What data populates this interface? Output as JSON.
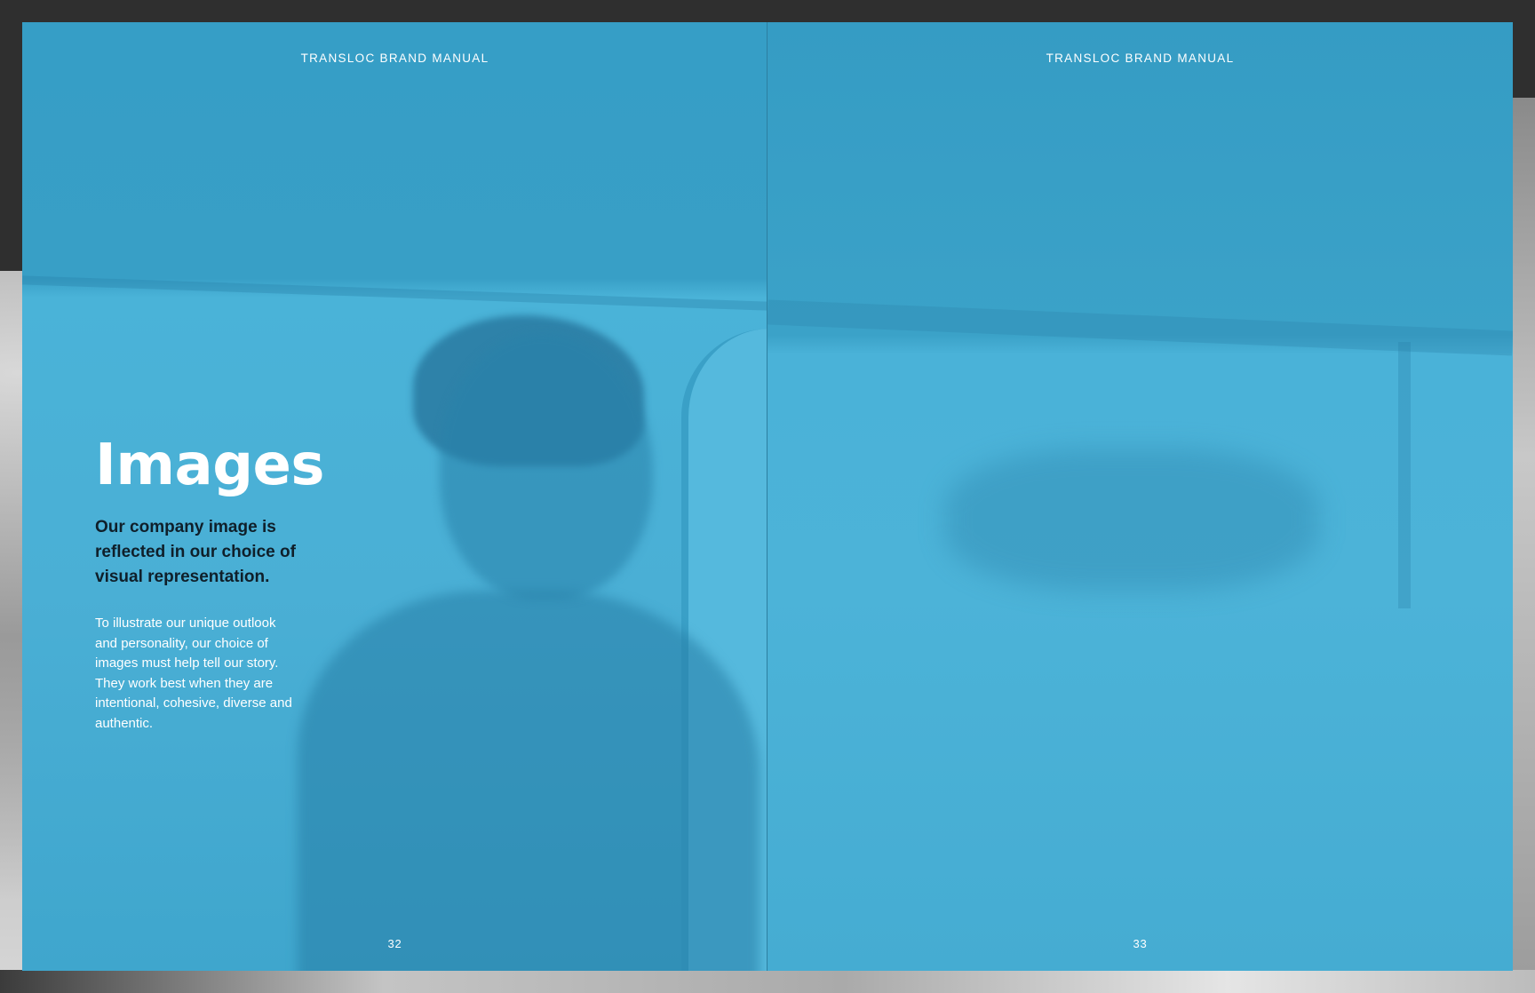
{
  "document": {
    "running_head": "TRANSLOC BRAND MANUAL",
    "left_page": {
      "folio": "32",
      "title": "Images",
      "lede": "Our company image is reflected in our choice of visual representation.",
      "body": "To illustrate our unique outlook and personality, our choice of images must help tell our story. They work best when they are intentional, cohesive, diverse and authentic."
    },
    "right_page": {
      "folio": "33"
    }
  },
  "colors": {
    "page_blue": "#4ab3d8",
    "lede_text": "#0f1f2a",
    "backdrop": "#2f2f2f"
  }
}
